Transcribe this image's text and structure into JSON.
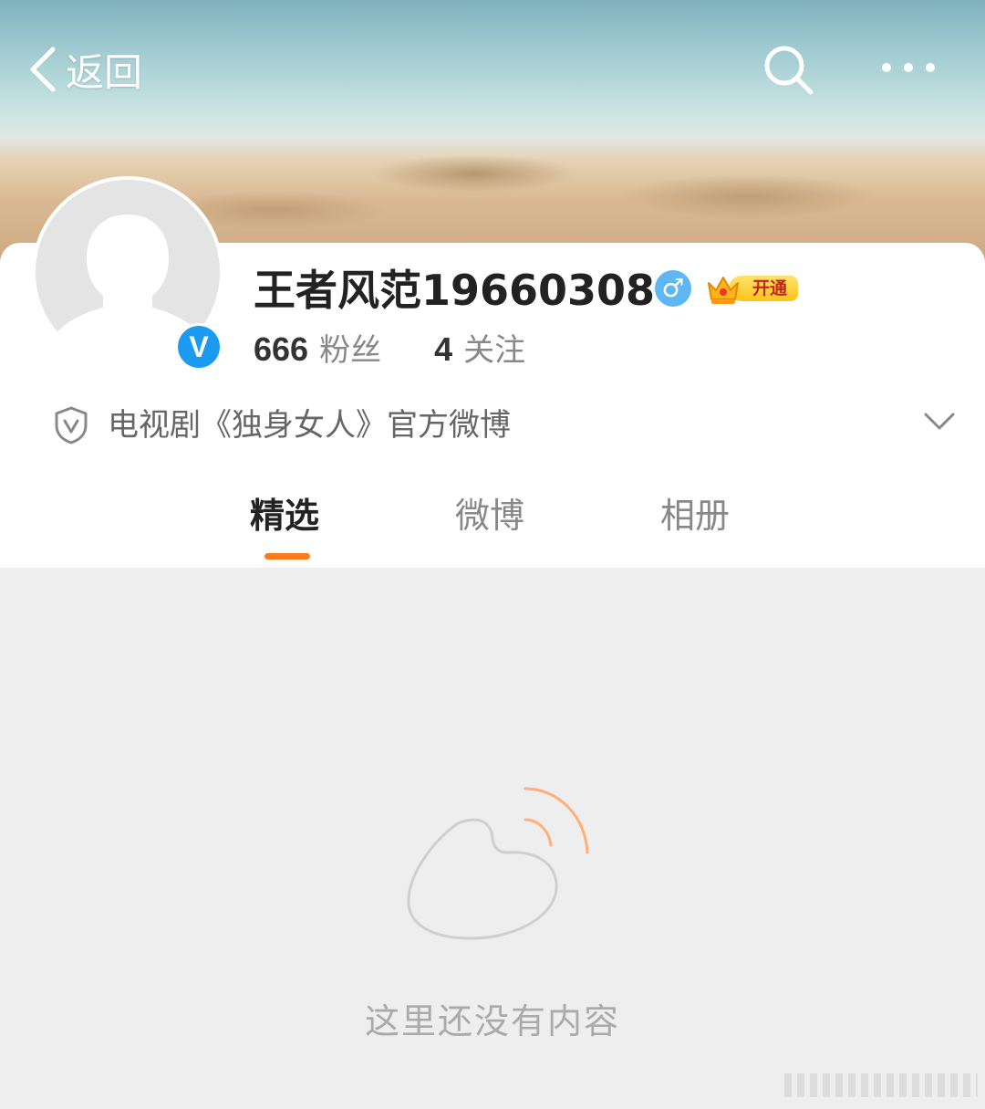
{
  "nav": {
    "back_label": "返回",
    "search_icon": "search-icon",
    "more_icon": "more-dots-icon"
  },
  "profile": {
    "username": "王者风范19660308",
    "gender": "♂",
    "verified_badge": "V",
    "vip_label": "开通",
    "followers_count": "666",
    "followers_label": "粉丝",
    "following_count": "4",
    "following_label": "关注",
    "description": "电视剧《独身女人》官方微博"
  },
  "tabs": [
    {
      "label": "精选",
      "active": true
    },
    {
      "label": "微博",
      "active": false
    },
    {
      "label": "相册",
      "active": false
    }
  ],
  "empty_state": {
    "message": "这里还没有内容",
    "icon": "weibo-logo-icon"
  },
  "colors": {
    "accent": "#ff7a1a",
    "verified_blue": "#1a9bf0",
    "gender_blue": "#5eb7f2",
    "empty_bg": "#eeeeee"
  }
}
